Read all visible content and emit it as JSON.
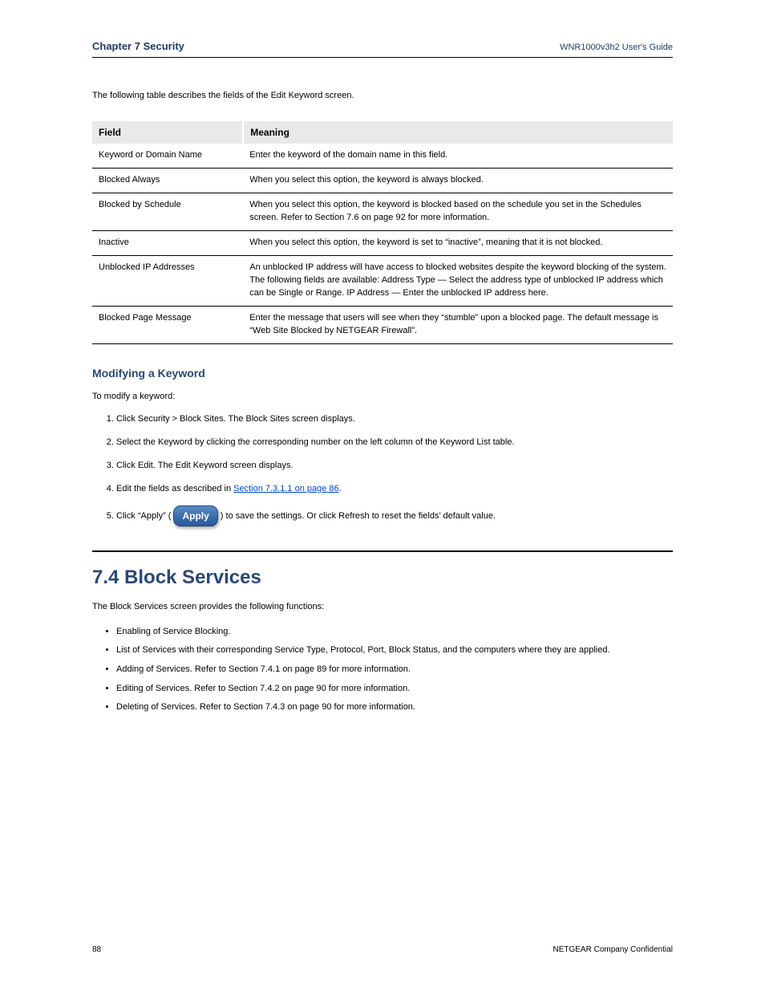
{
  "header": {
    "chapter": "Chapter 7    Security",
    "guide": "WNR1000v3h2 User's Guide"
  },
  "intro": "The following table describes the fields of the Edit Keyword screen.",
  "table": {
    "head": {
      "field": "Field",
      "desc": "Meaning"
    },
    "rows": [
      {
        "field": "Keyword or Domain Name",
        "desc": "Enter the keyword of the domain name in this field."
      },
      {
        "field": "Blocked Always",
        "desc": "When you select this option, the keyword is always blocked."
      },
      {
        "field": "Blocked by Schedule",
        "desc": "When you select this option, the keyword is blocked based on the schedule you set in the Schedules screen. Refer to Section 7.6 on page 92 for more information."
      },
      {
        "field": "Inactive",
        "desc": "When you select this option, the keyword is set to “inactive”, meaning that it is not blocked."
      },
      {
        "field": "Unblocked IP Addresses",
        "desc": "An unblocked IP address will have access to blocked websites despite the keyword blocking of the system. The following fields are available:  Address Type — Select the address type of unblocked IP address which can be Single or Range.  IP Address — Enter the unblocked IP address here."
      },
      {
        "field": "Blocked Page Message",
        "desc": "Enter the message that users will see when they “stumble” upon a blocked page. The default message is “Web Site Blocked by NETGEAR Firewall”."
      }
    ]
  },
  "modify_title": "Modifying a Keyword",
  "modify_lead": "To modify a keyword:",
  "steps": [
    {
      "text": "Click Security > Block Sites. The Block Sites screen displays."
    },
    {
      "text": "Select the Keyword by clicking the corresponding number on the left column of the Keyword List table."
    },
    {
      "text": "Click Edit. The Edit Keyword screen displays."
    },
    {
      "text_a": "Edit the fields as described in ",
      "link": "Section 7.3.1.1 on page 86",
      "text_b": "."
    },
    {
      "text_a": "Click “Apply” (",
      "text_b": ") to save the settings. Or click Refresh to reset the fields’ default value."
    }
  ],
  "h2": "7.4  Block Services",
  "sublead": "The Block Services screen provides the following functions:",
  "bullets": [
    "Enabling of Service Blocking.",
    "List of Services with their corresponding Service Type, Protocol, Port, Block Status, and the computers where they are applied.",
    "Adding of Services. Refer to Section 7.4.1 on page 89 for more information.",
    "Editing of Services. Refer to Section 7.4.2 on page 90 for more information.",
    "Deleting of Services. Refer to Section 7.4.3 on page 90 for more information."
  ],
  "footer": {
    "page": "88",
    "conf": "NETGEAR Company Confidential"
  }
}
